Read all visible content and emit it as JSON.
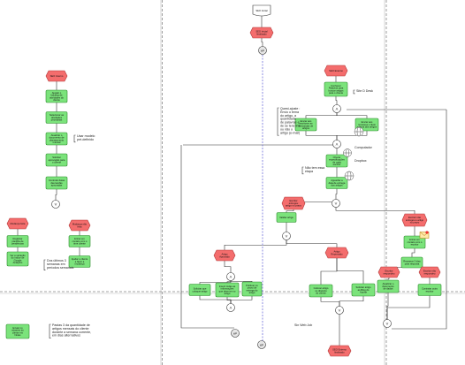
{
  "nodes": [
    {
      "id": "n_seo_in",
      "kind": "doc",
      "text": [
        "SEO Inicial"
      ]
    },
    {
      "id": "n_seo_fin",
      "kind": "event",
      "text": [
        "SEO Inicial",
        "finalizado"
      ]
    },
    {
      "id": "n_wp_top",
      "kind": "connector",
      "text": [
        "WP"
      ]
    },
    {
      "id": "n_l_start",
      "kind": "event",
      "text": [
        "SEO Interno"
      ]
    },
    {
      "id": "n_l_a1",
      "kind": "activity",
      "text": [
        "Ajustar o",
        "backlog de",
        "atividades do",
        "cliente"
      ]
    },
    {
      "id": "n_l_a2",
      "kind": "activity",
      "text": [
        "Selecionar as",
        "atividades",
        "prioritárias"
      ]
    },
    {
      "id": "n_l_a3",
      "kind": "activity",
      "text": [
        "Atualizar o",
        "documento de",
        "planejamento",
        "mensal"
      ]
    },
    {
      "id": "n_l_a4",
      "kind": "activity",
      "text": [
        "Solicitar",
        "aprovação para",
        "o cliente"
      ]
    },
    {
      "id": "n_l_a5",
      "kind": "activity",
      "text": [
        "Controlar datas",
        "das tarefas",
        "aprovadas"
      ]
    },
    {
      "id": "n_l_gw",
      "kind": "gateway",
      "text": [
        "V"
      ]
    },
    {
      "id": "n_l_ev1",
      "kind": "event",
      "text": [
        "Mudança feita"
      ]
    },
    {
      "id": "n_l_ev2",
      "kind": "event",
      "text": [
        "Mudança não",
        "feita"
      ]
    },
    {
      "id": "n_l_b1",
      "kind": "activity",
      "text": [
        "Registrar",
        "planilha de",
        "pendências"
      ]
    },
    {
      "id": "n_l_b2",
      "kind": "activity",
      "text": [
        "Entrar em",
        "contato com o",
        "time cliente"
      ]
    },
    {
      "id": "n_l_b3",
      "kind": "activity",
      "text": [
        "Ver a variação",
        "do índice de",
        "Google",
        "Analytics"
      ]
    },
    {
      "id": "n_l_b4",
      "kind": "activity",
      "text": [
        "Ajudar o cliente",
        "a fazer a",
        "mudança"
      ]
    },
    {
      "id": "n_l_b5",
      "kind": "activity",
      "text": [
        "Enviar no",
        "relatório do",
        "cliente em",
        "Notas"
      ]
    },
    {
      "id": "n_m_start",
      "kind": "event",
      "text": [
        "SEO Externo"
      ]
    },
    {
      "id": "n_m_a1",
      "kind": "activity",
      "text": [
        "Conhecer",
        "Palavras para",
        "buscar artigos",
        "para o cliente"
      ]
    },
    {
      "id": "n_m_gw1",
      "kind": "gateway",
      "text": [
        "Λ"
      ]
    },
    {
      "id": "n_m_a2",
      "kind": "activity",
      "text": [
        "Enviar aos",
        "escritores as",
        "demandas de",
        "artigos"
      ]
    },
    {
      "id": "n_m_a3",
      "kind": "activity",
      "text": [
        "Enviar aos",
        "revisores o título",
        "e tema dos artigos"
      ]
    },
    {
      "id": "n_m_gw2",
      "kind": "gateway",
      "text": [
        "Λ"
      ]
    },
    {
      "id": "n_m_a4",
      "kind": "activity",
      "text": [
        "Checar",
        "especificações",
        "de cada",
        "escritor"
      ]
    },
    {
      "id": "n_m_a5",
      "kind": "activity",
      "text": [
        "Aguardar a",
        "data de entrega",
        "dos artigos"
      ]
    },
    {
      "id": "n_m_gw3",
      "kind": "gateway",
      "text": [
        "V"
      ]
    },
    {
      "id": "n_m_ev1",
      "kind": "event",
      "text": [
        "Escritor",
        "entregou",
        "artigo no prazo"
      ]
    },
    {
      "id": "n_m_ev2",
      "kind": "event",
      "text": [
        "Escritor não",
        "entregou o artigo",
        "no prazo"
      ]
    },
    {
      "id": "n_m_a6",
      "kind": "activity",
      "text": [
        "Validar artigo"
      ]
    },
    {
      "id": "n_m_gw4",
      "kind": "gateway",
      "text": [
        "V"
      ]
    },
    {
      "id": "n_m_ev3",
      "kind": "event",
      "text": [
        "Artigo",
        "Aprovado"
      ]
    },
    {
      "id": "n_m_ev4",
      "kind": "event",
      "text": [
        "Artigo",
        "Reprovado"
      ]
    },
    {
      "id": "n_m_gw5",
      "kind": "gateway",
      "text": [
        "Λ"
      ]
    },
    {
      "id": "n_m_a7",
      "kind": "activity",
      "text": [
        "Solicitar que",
        "coloque artigo"
      ]
    },
    {
      "id": "n_m_a8",
      "kind": "activity",
      "text": [
        "Inserir todas as",
        "informações",
        "que deve ter no",
        "artigo"
      ]
    },
    {
      "id": "n_m_a9",
      "kind": "activity",
      "text": [
        "Publicar no",
        "prazo de",
        "entrega do",
        "artigo"
      ]
    },
    {
      "id": "n_m_gw6",
      "kind": "gateway",
      "text": [
        "Λ"
      ]
    },
    {
      "id": "n_m_a10",
      "kind": "activity",
      "text": [
        "Colocar artigo",
        "no diretório",
        "do cliente"
      ]
    },
    {
      "id": "n_m_a11",
      "kind": "activity",
      "text": [
        "Solicitar artigo",
        "ao Blog do",
        "Aporte"
      ]
    },
    {
      "id": "n_m_gw7",
      "kind": "gateway",
      "text": [
        "V"
      ]
    },
    {
      "id": "n_m_end",
      "kind": "event",
      "text": [
        "SEO Externo",
        "finalizado"
      ]
    },
    {
      "id": "n_r_a1",
      "kind": "activity",
      "text": [
        "Entrar em",
        "contato com o",
        "escritor"
      ]
    },
    {
      "id": "n_r_a2",
      "kind": "activity",
      "text": [
        "Repassar 3 dias",
        "para resposta"
      ]
    },
    {
      "id": "n_r_ev1",
      "kind": "event",
      "text": [
        "Escritor",
        "respondeu"
      ]
    },
    {
      "id": "n_r_ev2",
      "kind": "event",
      "text": [
        "Escritor não",
        "respondeu"
      ]
    },
    {
      "id": "n_r_a3",
      "kind": "activity",
      "text": [
        "Atualizar o",
        "documento",
        "de dados"
      ]
    },
    {
      "id": "n_r_a4",
      "kind": "activity",
      "text": [
        "Contratar outro",
        "escritor"
      ]
    },
    {
      "id": "n_r_gw",
      "kind": "gateway",
      "text": [
        "V"
      ]
    },
    {
      "id": "n_wp_mid",
      "kind": "connector",
      "text": [
        "WP"
      ]
    },
    {
      "id": "n_wp_bot",
      "kind": "connector",
      "text": [
        "WP"
      ]
    },
    {
      "id": "n_l_doc",
      "kind": "activity",
      "text": [
        "Pastas de",
        "arquivos de",
        "clientes em",
        "Blogs"
      ]
    }
  ],
  "annotations": [
    {
      "id": "an_modelo",
      "text": [
        "Usar modelo",
        "pré-definido"
      ]
    },
    {
      "id": "an_ultimos",
      "text": [
        "Dos últimos 3",
        "semanas em",
        "períodos semanais"
      ]
    },
    {
      "id": "an_quest",
      "text": [
        "Quest-ajuste :",
        "Envio o tema",
        "do artigo, a",
        "quantidade",
        "de palavras e",
        "de se terá link",
        "ou não o",
        "artigo (e-mail)"
      ]
    },
    {
      "id": "an_sitedesk",
      "text": [
        "Site D Desk"
      ]
    },
    {
      "id": "an_etapa",
      "text": [
        "Não tem essa",
        "etapa"
      ]
    },
    {
      "id": "an_drop",
      "text": [
        "Dropbox"
      ]
    },
    {
      "id": "an_webjob",
      "text": [
        "Sin Web Job"
      ]
    },
    {
      "id": "an_pastas",
      "text": [
        "Pastas 3 da quantidade de",
        "artigos mensais do cliente",
        "durante a semana corrente,",
        "em dias alternativos"
      ]
    },
    {
      "id": "an_computer",
      "text": [
        "Computador"
      ]
    }
  ]
}
